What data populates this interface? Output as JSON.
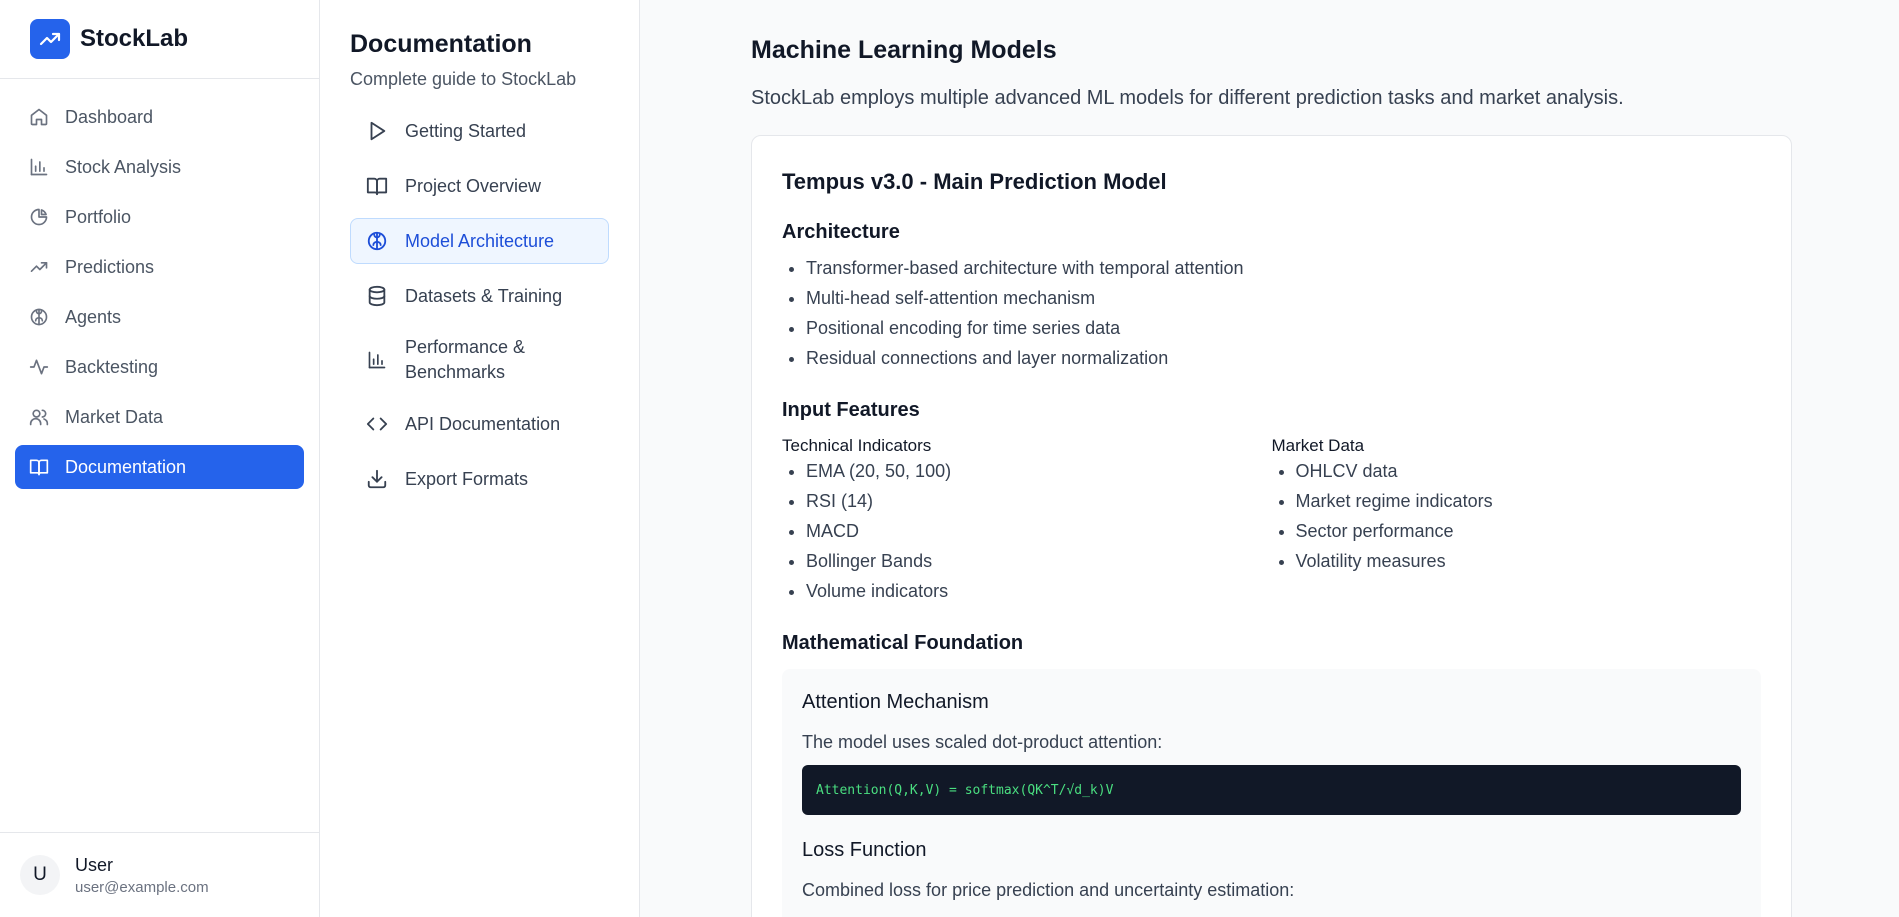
{
  "app": {
    "name": "StockLab",
    "accent_color": "#2563eb"
  },
  "sidebar": {
    "items": [
      {
        "label": "Dashboard",
        "icon": "home-icon"
      },
      {
        "label": "Stock Analysis",
        "icon": "bar-chart-icon"
      },
      {
        "label": "Portfolio",
        "icon": "pie-chart-icon"
      },
      {
        "label": "Predictions",
        "icon": "trending-up-icon"
      },
      {
        "label": "Agents",
        "icon": "brain-icon"
      },
      {
        "label": "Backtesting",
        "icon": "activity-icon"
      },
      {
        "label": "Market Data",
        "icon": "users-icon"
      },
      {
        "label": "Documentation",
        "icon": "book-icon",
        "active": true
      }
    ],
    "user": {
      "initial": "U",
      "name": "User",
      "email": "user@example.com"
    }
  },
  "docnav": {
    "title": "Documentation",
    "subtitle": "Complete guide to StockLab",
    "items": [
      {
        "label": "Getting Started",
        "icon": "play-icon"
      },
      {
        "label": "Project Overview",
        "icon": "book-open-icon"
      },
      {
        "label": "Model Architecture",
        "icon": "brain-icon",
        "active": true
      },
      {
        "label": "Datasets & Training",
        "icon": "database-icon"
      },
      {
        "label": "Performance & Benchmarks",
        "icon": "bar-chart-icon"
      },
      {
        "label": "API Documentation",
        "icon": "code-icon"
      },
      {
        "label": "Export Formats",
        "icon": "download-icon"
      }
    ]
  },
  "main": {
    "title": "Machine Learning Models",
    "lead": "StockLab employs multiple advanced ML models for different prediction tasks and market analysis.",
    "card": {
      "title": "Tempus v3.0 - Main Prediction Model",
      "architecture": {
        "heading": "Architecture",
        "items": [
          "Transformer-based architecture with temporal attention",
          "Multi-head self-attention mechanism",
          "Positional encoding for time series data",
          "Residual connections and layer normalization"
        ]
      },
      "features": {
        "heading": "Input Features",
        "technical": {
          "title": "Technical Indicators",
          "items": [
            "EMA (20, 50, 100)",
            "RSI (14)",
            "MACD",
            "Bollinger Bands",
            "Volume indicators"
          ]
        },
        "market": {
          "title": "Market Data",
          "items": [
            "OHLCV data",
            "Market regime indicators",
            "Sector performance",
            "Volatility measures"
          ]
        }
      },
      "math": {
        "heading": "Mathematical Foundation",
        "attention_title": "Attention Mechanism",
        "attention_text": "The model uses scaled dot-product attention:",
        "attention_code": "Attention(Q,K,V) = softmax(QK^T/√d_k)V",
        "loss_title": "Loss Function",
        "loss_text": "Combined loss for price prediction and uncertainty estimation:"
      }
    }
  }
}
